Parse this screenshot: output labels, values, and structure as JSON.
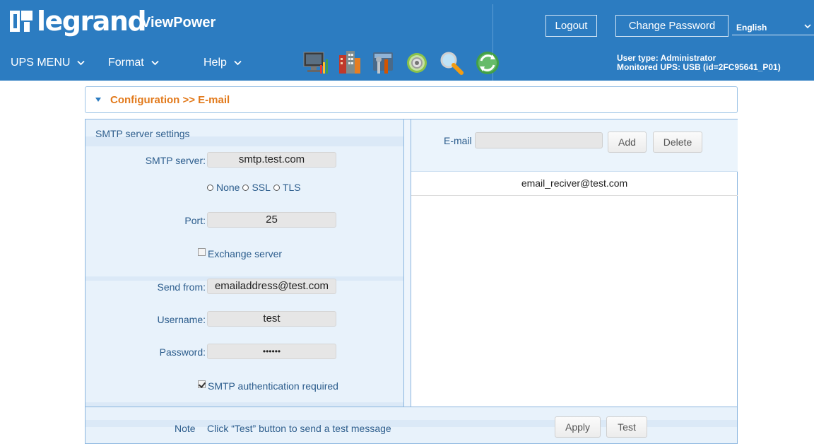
{
  "colors": {
    "header_bg": "#2c7cc1",
    "accent_orange": "#e27a1c",
    "label_blue": "#2b5c8c"
  },
  "header": {
    "logo_text": "legrand",
    "product": "ViewPower",
    "logout_label": "Logout",
    "change_password_label": "Change Password",
    "language": "English",
    "user_type": "User type: Administrator",
    "monitored_ups": "Monitored UPS: USB (id=2FC95641_P01)"
  },
  "menu": [
    {
      "label": "UPS MENU"
    },
    {
      "label": "Format"
    },
    {
      "label": "Help"
    }
  ],
  "toolbar_icons": [
    "monitor-chart-icon",
    "building-icon",
    "tools-icon",
    "gear-icon",
    "magnifier-icon",
    "refresh-icon"
  ],
  "breadcrumb": "Configuration >> E-mail",
  "smtp": {
    "title": "SMTP server settings",
    "server_label": "SMTP server:",
    "server_value": "smtp.test.com",
    "security_options": [
      "None",
      "SSL",
      "TLS"
    ],
    "port_label": "Port:",
    "port_value": "25",
    "exchange_label": "Exchange server",
    "exchange_checked": false,
    "send_from_label": "Send from:",
    "send_from_value": "emailaddress@test.com",
    "username_label": "Username:",
    "username_value": "test",
    "password_label": "Password:",
    "password_value": "••••••",
    "auth_label": "SMTP authentication required",
    "auth_checked": true
  },
  "recipients": {
    "email_label": "E-mail",
    "email_value": "",
    "add_label": "Add",
    "delete_label": "Delete",
    "list": [
      "email_reciver@test.com"
    ]
  },
  "footer": {
    "note_label": "Note",
    "note_text": "Click “Test” button to send a test message",
    "apply_label": "Apply",
    "test_label": "Test"
  }
}
